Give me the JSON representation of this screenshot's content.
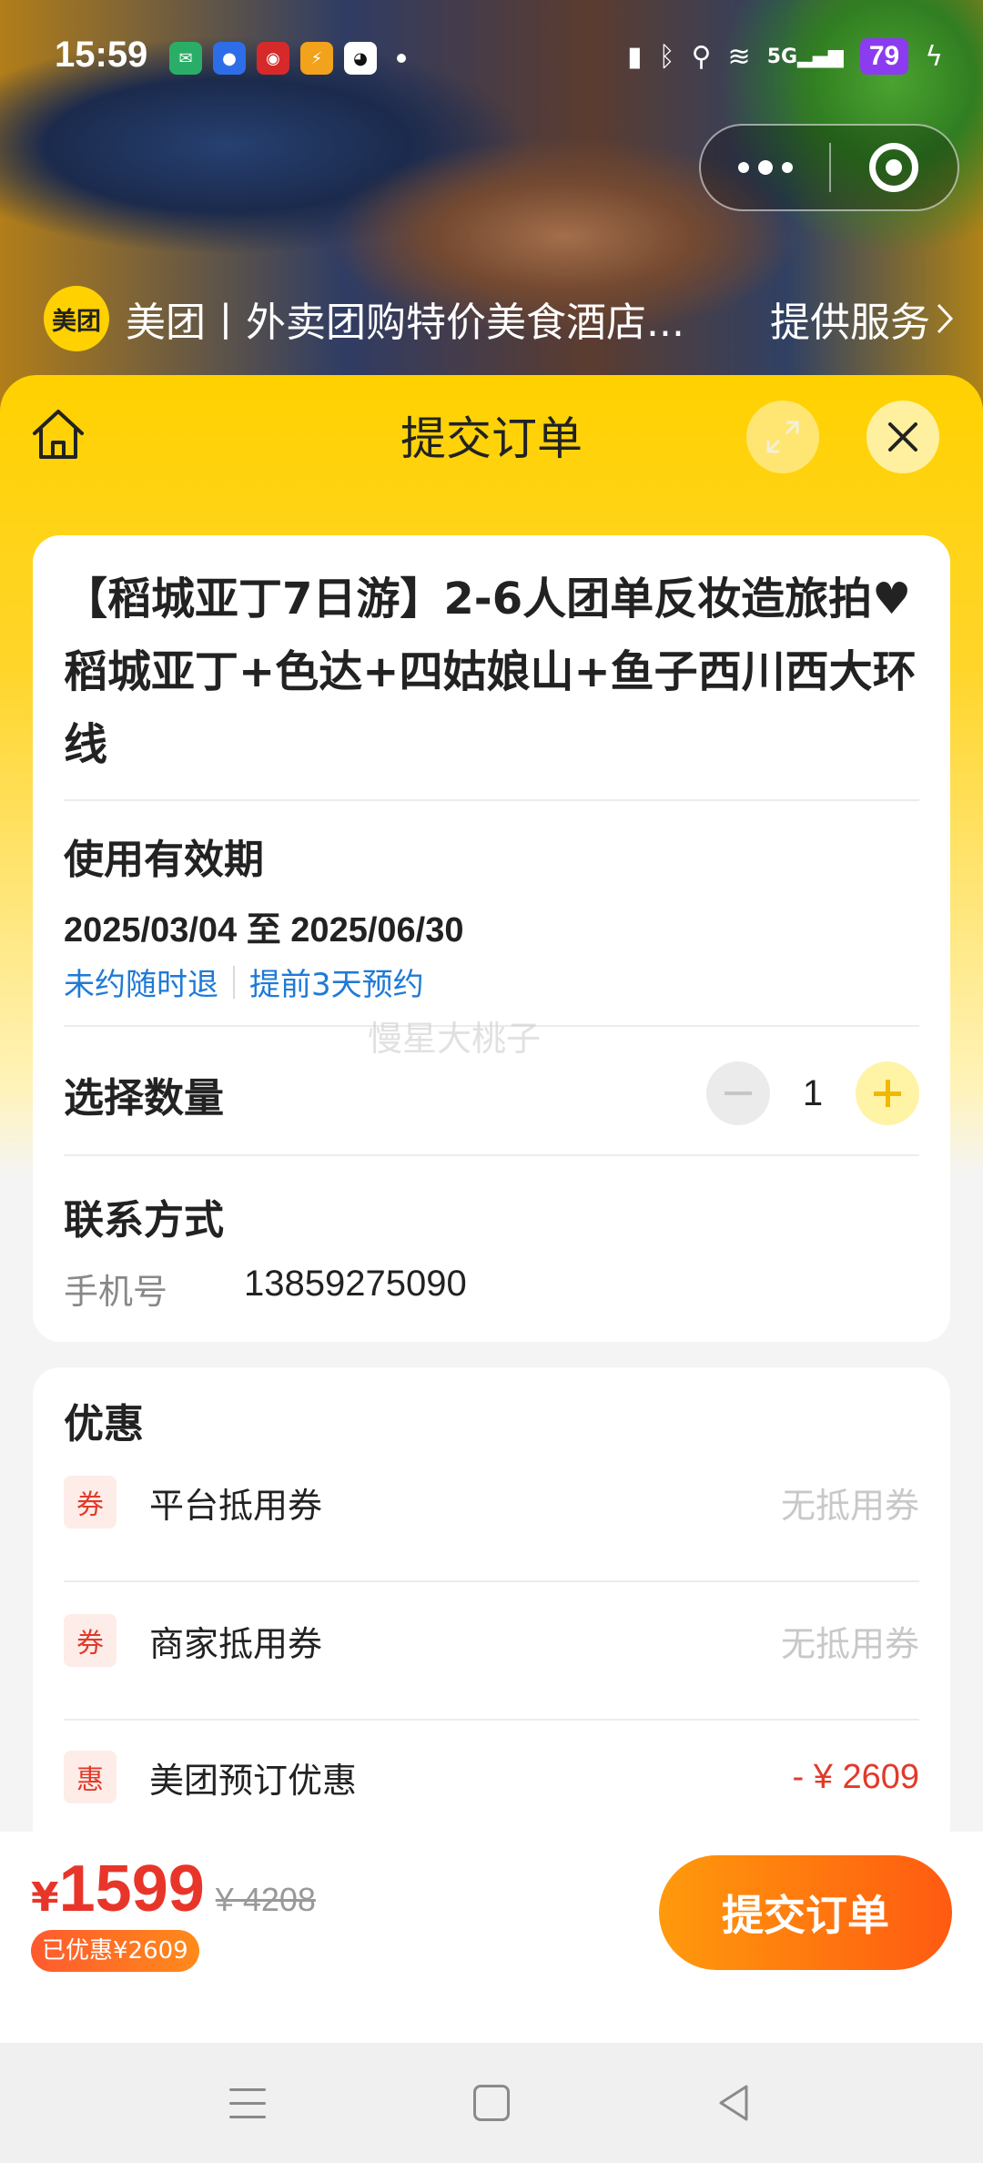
{
  "status_bar": {
    "time": "15:59",
    "battery": "79",
    "network": "5G"
  },
  "capsule": {
    "more_icon": "more-dots-icon",
    "close_icon": "target-icon"
  },
  "service_bar": {
    "logo_text": "美团",
    "name": "美团丨外卖团购特价美食酒店...",
    "link": "提供服务"
  },
  "nav": {
    "title": "提交订单",
    "home_icon": "home-icon",
    "expand_icon": "expand-icon",
    "close_icon": "close-icon"
  },
  "product": {
    "title": "【稻城亚丁7日游】2-6人团单反妆造旅拍♥稻城亚丁+色达+四姑娘山+鱼子西川西大环线",
    "validity_label": "使用有效期",
    "validity_range": "2025/03/04 至 2025/06/30",
    "tag1": "未约随时退",
    "tag2": "提前3天预约",
    "quantity_label": "选择数量",
    "quantity": "1",
    "contact_label": "联系方式",
    "phone_label": "手机号",
    "phone": "13859275090"
  },
  "watermark": "慢星大桃子",
  "discounts": {
    "title": "优惠",
    "items": [
      {
        "badge": "券",
        "name": "平台抵用券",
        "value": "无抵用券"
      },
      {
        "badge": "券",
        "name": "商家抵用券",
        "value": "无抵用券"
      },
      {
        "badge": "惠",
        "name": "美团预订优惠",
        "value": "- ¥ 2609"
      }
    ]
  },
  "checkout": {
    "currency": "¥",
    "price": "1599",
    "original_price": "¥ 4208",
    "saved": "已优惠¥2609",
    "submit": "提交订单"
  },
  "colors": {
    "brand_yellow": "#ffd100",
    "price_red": "#e8352a",
    "link_blue": "#1f7ad6",
    "submit_orange": "#ff6a12"
  }
}
